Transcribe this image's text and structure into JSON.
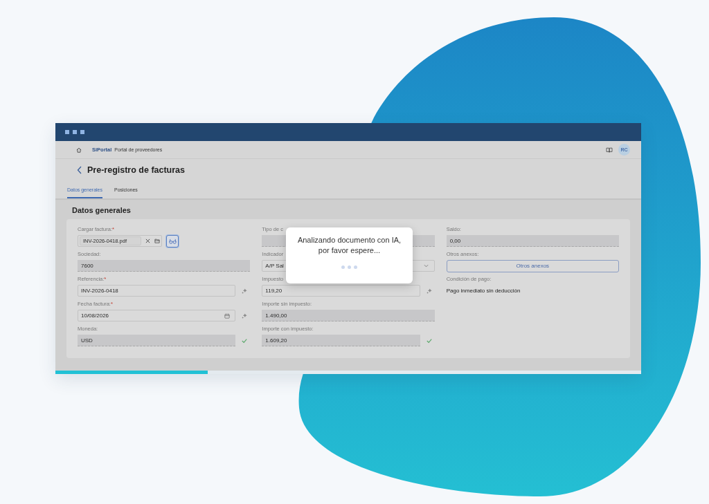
{
  "window": {
    "progress": {
      "level": 0.26
    }
  },
  "nav": {
    "brand": "SiPortal",
    "subtitle": "Portal de proveedores",
    "avatar": "RC"
  },
  "page": {
    "title": "Pre-registro de facturas"
  },
  "tabs": [
    {
      "label": "Datos generales",
      "selected": true
    },
    {
      "label": "Posiciones",
      "selected": false
    }
  ],
  "section": {
    "title": "Datos generales",
    "columns": [
      {
        "fields": [
          {
            "kind": "upload",
            "label": "Cargar factura:",
            "required_mark": "*",
            "value": "INV-2026-0418.pdf",
            "ai_suggested": false,
            "verified": false
          },
          {
            "kind": "readonly",
            "label": "Sociedad:",
            "value": "7600",
            "ai_suggested": false,
            "verified": false
          },
          {
            "kind": "input",
            "label": "Referencia:",
            "required_mark": "*",
            "value": "INV-2026-0418",
            "ai_suggested": true,
            "verified": false
          },
          {
            "kind": "date",
            "label": "Fecha factura:",
            "required_mark": "*",
            "value": "10/08/2026",
            "ai_suggested": true,
            "verified": false
          },
          {
            "kind": "readonly",
            "label": "Moneda:",
            "value": "USD",
            "ai_suggested": false,
            "verified": true
          }
        ]
      },
      {
        "fields": [
          {
            "kind": "readonly",
            "label": "Tipo de c",
            "ai_suggested": false,
            "verified": false
          },
          {
            "kind": "select",
            "label": "Indicador",
            "value": "A/P Sal",
            "ai_suggested": false,
            "verified": false
          },
          {
            "kind": "input",
            "label": "Impuesto",
            "value": "119,20",
            "ai_suggested": true,
            "verified": false
          },
          {
            "kind": "readonly",
            "label": "Importe sin impuesto:",
            "value": "1.490,00",
            "ai_suggested": false,
            "verified": false
          },
          {
            "kind": "readonly",
            "label": "Importe con impuesto:",
            "value": "1.609,20",
            "ai_suggested": false,
            "verified": true
          }
        ]
      },
      {
        "fields": [
          {
            "kind": "readonly",
            "label": "Saldo:",
            "value": "0,00",
            "ai_suggested": false,
            "verified": false
          },
          {
            "kind": "button",
            "label": "Otros anexos:",
            "value": "Otros anexos",
            "ai_suggested": false,
            "verified": false
          },
          {
            "kind": "text",
            "label": "Condición de pago:",
            "value": "Pago inmediato sin deducción",
            "ai_suggested": false,
            "verified": false
          }
        ]
      }
    ]
  },
  "modal": {
    "message": "Analizando documento con IA,\npor favor espere..."
  }
}
